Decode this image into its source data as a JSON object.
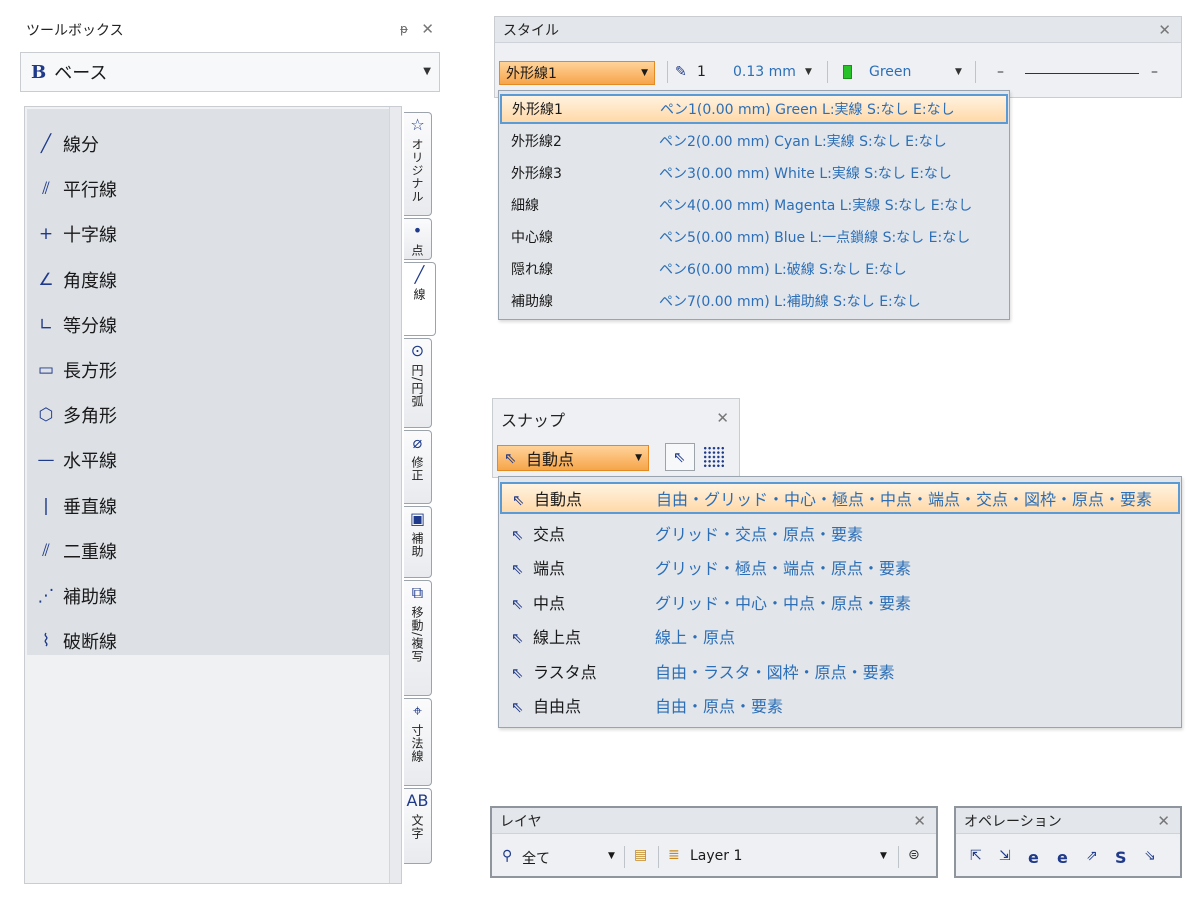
{
  "toolbox": {
    "title": "ツールボックス",
    "pin": "ᵽ",
    "close": "✕",
    "category": {
      "icon": "B",
      "label": "ベース"
    },
    "tools": [
      {
        "icon": "╱",
        "label": "線分"
      },
      {
        "icon": "⫽",
        "label": "平行線"
      },
      {
        "icon": "+",
        "label": "十字線"
      },
      {
        "icon": "∠",
        "label": "角度線"
      },
      {
        "icon": "∟",
        "label": "等分線"
      },
      {
        "icon": "▭",
        "label": "長方形"
      },
      {
        "icon": "⬡",
        "label": "多角形"
      },
      {
        "icon": "—",
        "label": "水平線"
      },
      {
        "icon": "|",
        "label": "垂直線"
      },
      {
        "icon": "⫽",
        "label": "二重線"
      },
      {
        "icon": "⋰",
        "label": "補助線"
      },
      {
        "icon": "⌇",
        "label": "破断線"
      }
    ],
    "tabs": [
      {
        "icon": "☆",
        "label": "オリジナル"
      },
      {
        "icon": "•",
        "label": "点"
      },
      {
        "icon": "╱",
        "label": "線"
      },
      {
        "icon": "⊙",
        "label": "円/円弧"
      },
      {
        "icon": "⌀",
        "label": "修正"
      },
      {
        "icon": "▣",
        "label": "補助"
      },
      {
        "icon": "⧉",
        "label": "移動/複写"
      },
      {
        "icon": "⌖",
        "label": "寸法線"
      },
      {
        "icon": "AB",
        "label": "文字"
      }
    ]
  },
  "style": {
    "title": "スタイル",
    "close": "✕",
    "combo": "外形線1",
    "pen": "1",
    "width": "0.13 mm",
    "color_name": "Green",
    "color_hex": "#27c227",
    "line_left": "–",
    "line_right": "–",
    "items": [
      {
        "name": "外形線1",
        "desc": "ペン1(0.00 mm) Green L:実線 S:なし E:なし"
      },
      {
        "name": "外形線2",
        "desc": "ペン2(0.00 mm) Cyan L:実線 S:なし E:なし"
      },
      {
        "name": "外形線3",
        "desc": "ペン3(0.00 mm) White L:実線 S:なし E:なし"
      },
      {
        "name": "細線",
        "desc": "ペン4(0.00 mm) Magenta L:実線 S:なし E:なし"
      },
      {
        "name": "中心線",
        "desc": "ペン5(0.00 mm) Blue L:一点鎖線 S:なし E:なし"
      },
      {
        "name": "隠れ線",
        "desc": "ペン6(0.00 mm)  L:破線 S:なし E:なし"
      },
      {
        "name": "補助線",
        "desc": "ペン7(0.00 mm)  L:補助線 S:なし E:なし"
      }
    ]
  },
  "snap": {
    "title": "スナップ",
    "close": "✕",
    "combo": "自動点",
    "items": [
      {
        "name": "自動点",
        "desc": "自由・グリッド・中心・極点・中点・端点・交点・図枠・原点・要素"
      },
      {
        "name": "交点",
        "desc": "グリッド・交点・原点・要素"
      },
      {
        "name": "端点",
        "desc": "グリッド・極点・端点・原点・要素"
      },
      {
        "name": "中点",
        "desc": "グリッド・中心・中点・原点・要素"
      },
      {
        "name": "線上点",
        "desc": "線上・原点"
      },
      {
        "name": "ラスタ点",
        "desc": "自由・ラスタ・図枠・原点・要素"
      },
      {
        "name": "自由点",
        "desc": "自由・原点・要素"
      }
    ]
  },
  "layer": {
    "title": "レイヤ",
    "close": "✕",
    "filter": "全て",
    "layer_name": "Layer 1"
  },
  "operation": {
    "title": "オペレーション",
    "close": "✕",
    "icons": [
      "⇱",
      "⇲",
      "e",
      "e",
      "⇗",
      "S",
      "⇘"
    ]
  }
}
